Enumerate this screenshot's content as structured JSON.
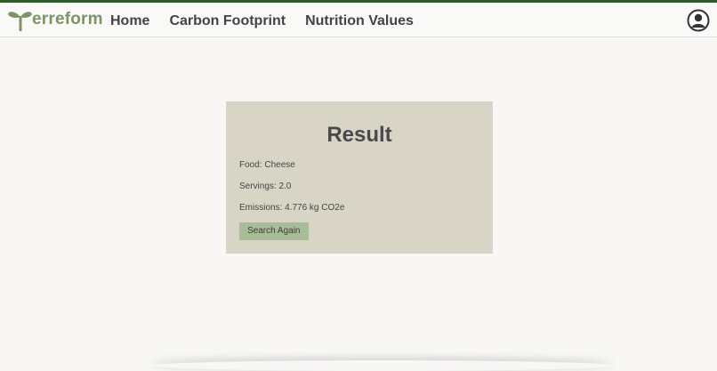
{
  "header": {
    "logo_text": "erreform",
    "nav": [
      {
        "label": "Home"
      },
      {
        "label": "Carbon Footprint"
      },
      {
        "label": "Nutrition Values"
      }
    ]
  },
  "result": {
    "title": "Result",
    "food": "Food: Cheese",
    "servings": "Servings: 2.0",
    "emissions": "Emissions: 4.776 kg CO2e",
    "button_label": "Search Again"
  },
  "colors": {
    "accent_bar": "#2f5a2c",
    "logo": "#7d9467",
    "card": "#d8d5c7",
    "button": "#a9bc98"
  },
  "icons": {
    "logo": "sprout-icon",
    "profile": "user-circle-icon"
  }
}
